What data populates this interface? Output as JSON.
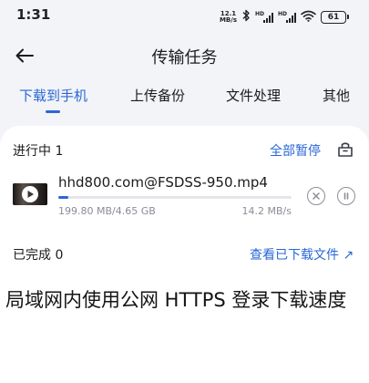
{
  "status_bar": {
    "time": "1:31",
    "net_speed_value": "12.1",
    "net_speed_unit": "MB/s",
    "sim1_label": "HD",
    "sim2_label": "HD",
    "battery": "61",
    "icons": [
      "bluetooth-icon",
      "signal-icon",
      "signal-icon",
      "wifi-icon",
      "battery-icon"
    ]
  },
  "header": {
    "title": "传输任务",
    "back_icon": "arrow-left-icon"
  },
  "tabs": [
    {
      "label": "下载到手机",
      "active": true
    },
    {
      "label": "上传备份",
      "active": false
    },
    {
      "label": "文件处理",
      "active": false
    },
    {
      "label": "其他",
      "active": false
    }
  ],
  "in_progress": {
    "heading": "进行中 1",
    "pause_all": "全部暂停",
    "icon": "package-icon"
  },
  "task": {
    "file_name": "hhd800.com@FSDSS-950.mp4",
    "size_progress": "199.80 MB/4.65 GB",
    "speed": "14.2 MB/s",
    "progress": 0.042,
    "cancel_icon": "close-circle-icon",
    "pause_icon": "pause-circle-icon"
  },
  "completed": {
    "heading": "已完成 0",
    "view_link": "查看已下载文件 ↗"
  },
  "caption": "局域网内使用公网 HTTPS 登录下载速度",
  "colors": {
    "accent": "#2967d5",
    "background": "#f3f4f8",
    "card": "#ffffff",
    "muted_text": "#8a8d96"
  }
}
